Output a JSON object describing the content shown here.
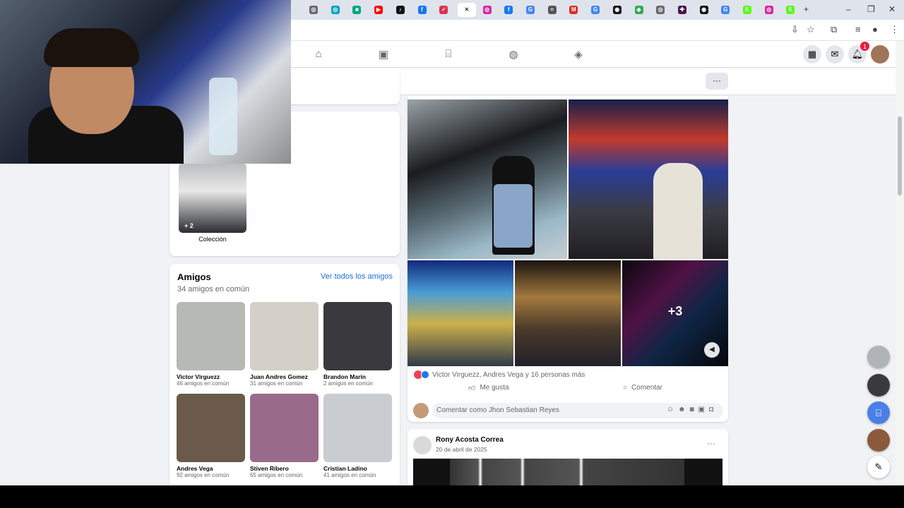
{
  "browser": {
    "tabs": [
      {
        "icon": "generic-tab-icon",
        "glyph": "◎",
        "color": "#666666"
      },
      {
        "icon": "circle-tab-icon",
        "glyph": "◎",
        "color": "#00a0c6"
      },
      {
        "icon": "chat-tab-icon",
        "glyph": "■",
        "color": "#00a884"
      },
      {
        "icon": "youtube-tab-icon",
        "glyph": "▶",
        "color": "#ff0000"
      },
      {
        "icon": "tiktok-tab-icon",
        "glyph": "♪",
        "color": "#111111"
      },
      {
        "icon": "facebook-tab-icon",
        "glyph": "f",
        "color": "#1877f2"
      },
      {
        "icon": "pocket-tab-icon",
        "glyph": "✓",
        "color": "#e0304e"
      },
      {
        "icon": "close-icon",
        "glyph": "✕",
        "color": "#333333"
      },
      {
        "icon": "instagram-tab-icon",
        "glyph": "◎",
        "color": "#d6249f"
      },
      {
        "icon": "facebook-tab-icon",
        "glyph": "f",
        "color": "#1877f2"
      },
      {
        "icon": "google-tab-icon",
        "glyph": "G",
        "color": "#4285f4"
      },
      {
        "icon": "generic-tab-icon",
        "glyph": "≈",
        "color": "#555555"
      },
      {
        "icon": "gmail-tab-icon",
        "glyph": "M",
        "color": "#d93025"
      },
      {
        "icon": "google-tab-icon",
        "glyph": "G",
        "color": "#4285f4"
      },
      {
        "icon": "chatgpt-tab-icon",
        "glyph": "◉",
        "color": "#111111"
      },
      {
        "icon": "maps-tab-icon",
        "glyph": "◆",
        "color": "#34a853"
      },
      {
        "icon": "generic-tab-icon",
        "glyph": "◎",
        "color": "#666666"
      },
      {
        "icon": "slack-tab-icon",
        "glyph": "✚",
        "color": "#4a154b"
      },
      {
        "icon": "chatgpt-tab-icon",
        "glyph": "◉",
        "color": "#111111"
      },
      {
        "icon": "google-tab-icon",
        "glyph": "G",
        "color": "#4285f4"
      },
      {
        "icon": "kick-tab-icon",
        "glyph": "K",
        "color": "#53fc18"
      },
      {
        "icon": "instagram-tab-icon",
        "glyph": "◎",
        "color": "#d6249f"
      },
      {
        "icon": "kick-tab-icon",
        "glyph": "K",
        "color": "#53fc18"
      }
    ],
    "new_tab": "+",
    "window_controls": {
      "minimize": "–",
      "restore": "❐",
      "close": "✕"
    }
  },
  "facebook": {
    "notifications_count": "1",
    "more_button": "···"
  },
  "collection": {
    "overlay_count": "+ 2",
    "label": "Colección"
  },
  "friends": {
    "title": "Amigos",
    "see_all": "Ver todos los amigos",
    "mutual_count": "34 amigos en común",
    "items": [
      {
        "name": "Victor Virguezz",
        "mutual": "46 amigos en común",
        "color": "#b7b9b5"
      },
      {
        "name": "Juan Andres Gomez",
        "mutual": "31 amigos en común",
        "color": "#d4cfc8"
      },
      {
        "name": "Brandon Marin",
        "mutual": "2 amigos en común",
        "color": "#3a3a3e"
      },
      {
        "name": "Andres Vega",
        "mutual": "92 amigos en común",
        "color": "#6b5a4a"
      },
      {
        "name": "Stiven Ribero",
        "mutual": "65 amigos en común",
        "color": "#9a6a8a"
      },
      {
        "name": "Cristian Ladino",
        "mutual": "41 amigos en común",
        "color": "#c9ccd1"
      }
    ]
  },
  "post": {
    "more_photos": "+3",
    "reactions_text": "Victor Virguezz, Andres Vega y 16 personas más",
    "like_label": "Me gusta",
    "comment_label": "Comentar",
    "comment_placeholder": "Comentar como Jhon Sebastian Reyes"
  },
  "next_post": {
    "author": "Rony Acosta Correa",
    "date": "20 de abril de 2025",
    "more": "···"
  }
}
